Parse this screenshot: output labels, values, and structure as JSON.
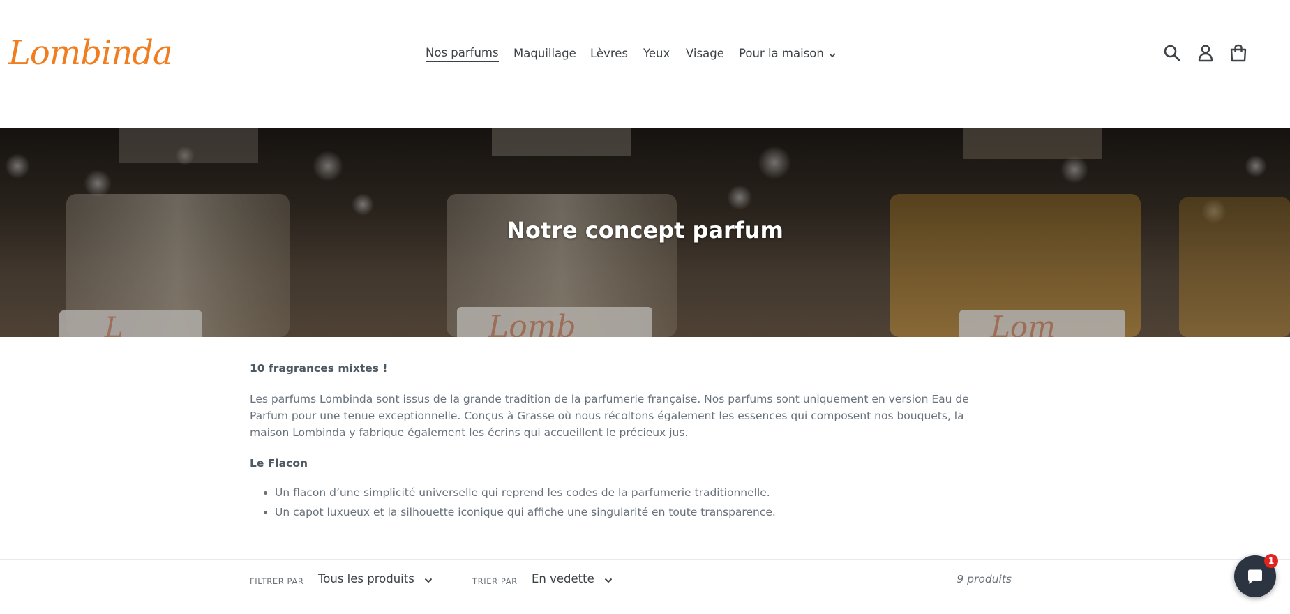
{
  "header": {
    "logo_text": "Lombinda",
    "nav": [
      {
        "label": "Nos parfums",
        "active": true
      },
      {
        "label": "Maquillage"
      },
      {
        "label": "Lèvres"
      },
      {
        "label": "Yeux"
      },
      {
        "label": "Visage"
      },
      {
        "label": "Pour la maison",
        "has_dropdown": true
      }
    ],
    "icons": [
      "search-icon",
      "account-icon",
      "cart-icon"
    ]
  },
  "hero": {
    "title": "Notre concept parfum"
  },
  "content": {
    "heading": "10 fragrances mixtes  !",
    "paragraph": "Les parfums Lombinda sont issus de la grande tradition de la parfumerie française. Nos parfums sont uniquement en version Eau de Parfum pour une tenue exceptionnelle. Conçus à Grasse où nous récoltons également les essences qui composent nos bouquets, la maison Lombinda y fabrique également les écrins qui accueillent le précieux jus.",
    "subheading": "Le Flacon",
    "bullets": [
      "Un flacon d’une simplicité universelle qui reprend les codes de la parfumerie traditionnelle.",
      "Un capot luxueux et la silhouette iconique qui affiche une singularité en toute transparence."
    ]
  },
  "filters": {
    "filter_label": "FILTRER PAR",
    "filter_value": "Tous les produits",
    "sort_label": "TRIER PAR",
    "sort_value": "En vedette",
    "count": "9 produits"
  },
  "chat": {
    "badge": "1"
  },
  "colors": {
    "brand": "#f07d1f",
    "text": "#3d4246",
    "muted": "#69727b",
    "chat": "#2b3440",
    "badge": "#e0241f"
  }
}
